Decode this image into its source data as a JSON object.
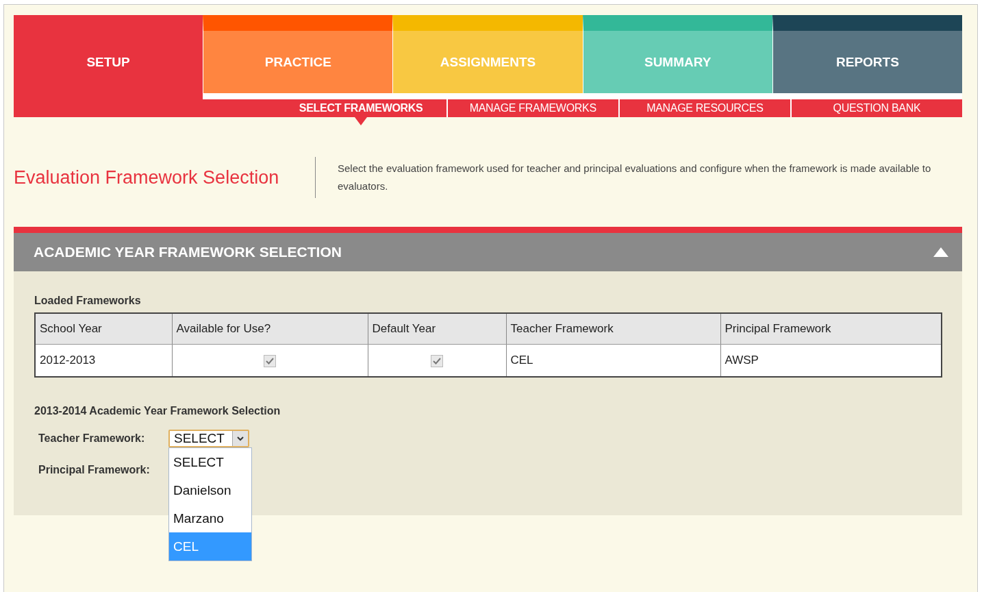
{
  "tabs": [
    {
      "label": "SETUP",
      "kind": "setup",
      "selected": true
    },
    {
      "label": "PRACTICE",
      "kind": "practice",
      "selected": false
    },
    {
      "label": "ASSIGNMENTS",
      "kind": "assignments",
      "selected": false
    },
    {
      "label": "SUMMARY",
      "kind": "summary",
      "selected": false
    },
    {
      "label": "REPORTS",
      "kind": "reports",
      "selected": false
    }
  ],
  "subtabs": [
    {
      "label": "SELECT FRAMEWORKS",
      "selected": true
    },
    {
      "label": "MANAGE FRAMEWORKS",
      "selected": false
    },
    {
      "label": "MANAGE RESOURCES",
      "selected": false
    },
    {
      "label": "QUESTION BANK",
      "selected": false
    }
  ],
  "page": {
    "title": "Evaluation Framework Selection",
    "description": "Select the evaluation framework used for teacher and principal evaluations and configure when the framework is made available to evaluators."
  },
  "panel": {
    "title": "ACADEMIC YEAR FRAMEWORK SELECTION",
    "expanded": true,
    "table_title": "Loaded Frameworks",
    "table": {
      "columns": [
        "School Year",
        "Available for Use?",
        "Default Year",
        "Teacher Framework",
        "Principal Framework"
      ],
      "rows": [
        {
          "school_year": "2012-2013",
          "available": true,
          "default_year": true,
          "teacher_framework": "CEL",
          "principal_framework": "AWSP"
        }
      ]
    },
    "form_title": "2013-2014 Academic Year Framework Selection",
    "teacher_label": "Teacher Framework:",
    "teacher_value": "SELECT",
    "principal_label": "Principal Framework:",
    "dropdown_open": true,
    "options": [
      {
        "label": "SELECT",
        "selected": false
      },
      {
        "label": "Danielson",
        "selected": false
      },
      {
        "label": "Marzano",
        "selected": false
      },
      {
        "label": "CEL",
        "selected": true
      }
    ]
  }
}
